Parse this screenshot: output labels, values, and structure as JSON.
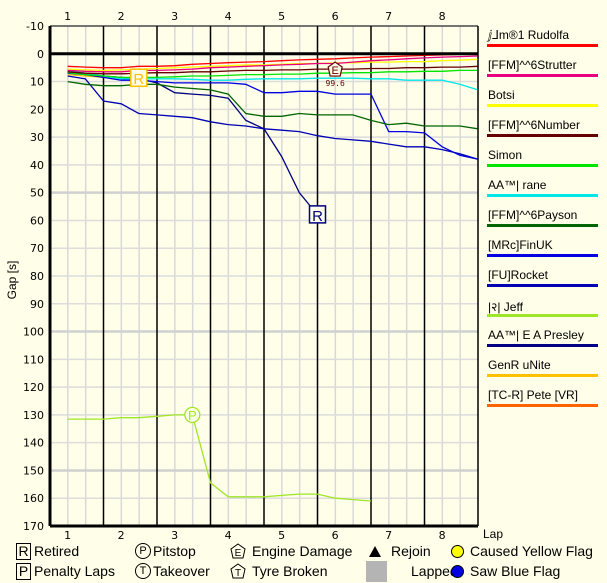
{
  "chart_data": {
    "type": "line",
    "title": "",
    "xlabel": "Lap",
    "ylabel": "Gap [s]",
    "x_ticks": [
      "1",
      "2",
      "3",
      "4",
      "5",
      "6",
      "7",
      "8"
    ],
    "y_ticks": [
      "-10",
      "0",
      "10",
      "20",
      "30",
      "40",
      "50",
      "60",
      "70",
      "80",
      "90",
      "100",
      "110",
      "120",
      "130",
      "140",
      "150",
      "160",
      "170"
    ],
    "xlim": [
      0.67,
      8.67
    ],
    "ylim": [
      -10,
      170
    ],
    "y_inverted": true,
    "grid": true,
    "legend_position": "right",
    "series": [
      {
        "name": "ⅉ⅃m®1 Rudolfa",
        "color": "#ff0000",
        "x": [
          1,
          1.33,
          1.67,
          2,
          2.33,
          2.67,
          3,
          3.33,
          3.67,
          4,
          4.33,
          4.67,
          5,
          5.33,
          5.67,
          6,
          6.33,
          6.67,
          7,
          7.33,
          7.67,
          8,
          8.33,
          8.67
        ],
        "y": [
          4.5,
          4.8,
          5.0,
          5.0,
          4.5,
          4.5,
          4.3,
          3.8,
          3.5,
          3.2,
          3.0,
          2.8,
          2.5,
          2.2,
          2.0,
          1.8,
          1.5,
          1.2,
          1.0,
          0.8,
          0.6,
          0.4,
          0.2,
          0
        ]
      },
      {
        "name": "[FFM]^^6Strutter",
        "color": "#e8007e",
        "x": [
          1,
          1.33,
          1.67,
          2,
          2.33,
          2.67,
          3,
          3.33,
          3.67,
          4,
          4.33,
          4.67,
          5,
          5.33,
          5.67,
          6,
          6.33,
          6.67,
          7,
          7.33,
          7.67,
          8,
          8.33,
          8.67
        ],
        "y": [
          6.0,
          6.3,
          6.5,
          6.5,
          6.0,
          6.0,
          5.8,
          5.5,
          5.0,
          4.8,
          4.5,
          4.3,
          4.0,
          3.8,
          3.5,
          3.5,
          3.0,
          2.5,
          2.2,
          1.8,
          1.5,
          1.2,
          1.0,
          0.8
        ]
      },
      {
        "name": "Botsi",
        "color": "#ffff00",
        "x": [
          1,
          1.33,
          1.67,
          2,
          2.33,
          2.67,
          3,
          3.33,
          3.67,
          4,
          4.33,
          4.67,
          5,
          5.33,
          5.67,
          6,
          6.33,
          6.67,
          7,
          7.33,
          7.67,
          8,
          8.33,
          8.67
        ],
        "y": [
          5.5,
          5.8,
          6.0,
          5.8,
          5.5,
          5.3,
          5.0,
          4.8,
          4.5,
          4.3,
          4.0,
          4.0,
          3.8,
          3.5,
          3.5,
          3.3,
          3.3,
          3.0,
          3.0,
          2.8,
          2.8,
          2.5,
          2.3,
          2.0
        ]
      },
      {
        "name": "[FFM]^^6Number",
        "color": "#640000",
        "x": [
          1,
          1.33,
          1.67,
          2,
          2.33,
          2.67,
          3,
          3.33,
          3.67,
          4,
          4.33,
          4.67,
          5,
          5.33,
          5.67,
          6,
          6.33,
          6.67,
          7,
          7.33,
          7.67,
          8,
          8.33,
          8.67
        ],
        "y": [
          6.5,
          7.0,
          7.2,
          7.2,
          7.0,
          6.8,
          6.8,
          6.5,
          6.5,
          6.2,
          6.0,
          6.0,
          5.8,
          5.8,
          5.5,
          5.5,
          5.5,
          5.3,
          5.3,
          5.0,
          5.0,
          4.8,
          4.8,
          4.5
        ]
      },
      {
        "name": "Simon",
        "color": "#00e400",
        "x": [
          1,
          1.33,
          1.67,
          2,
          2.33,
          2.67,
          3,
          3.33,
          3.67,
          4,
          4.33,
          4.67,
          5,
          5.33,
          5.67,
          6,
          6.33,
          6.67,
          7,
          7.33,
          7.67,
          8,
          8.33,
          8.67
        ],
        "y": [
          6.8,
          7.5,
          8.0,
          8.5,
          8.5,
          8.5,
          8.3,
          8.0,
          8.0,
          7.8,
          7.5,
          7.5,
          7.3,
          7.3,
          7.0,
          7.0,
          6.8,
          6.8,
          6.5,
          6.5,
          6.3,
          6.3,
          6.0,
          6.0
        ]
      },
      {
        "name": "AA™| rane",
        "color": "#00e8e8",
        "x": [
          1,
          1.33,
          1.67,
          2,
          2.33,
          2.67,
          3,
          3.33,
          3.67,
          4,
          4.33,
          4.67,
          5,
          5.33,
          5.67,
          6,
          6.33,
          6.67,
          7,
          7.33,
          7.67,
          8,
          8.33,
          8.67
        ],
        "y": [
          6.0,
          7.0,
          8.0,
          9.0,
          9.0,
          9.0,
          9.0,
          9.2,
          9.5,
          9.5,
          9.2,
          9.0,
          9.0,
          9.0,
          8.8,
          8.8,
          8.8,
          9.0,
          9.0,
          9.5,
          9.5,
          9.5,
          11.0,
          13.0
        ]
      },
      {
        "name": "[FFM]^^6Payson",
        "color": "#006400",
        "x": [
          1,
          1.33,
          1.67,
          2,
          2.33,
          2.67,
          3,
          3.33,
          3.67,
          4,
          4.33,
          4.67,
          5,
          5.33,
          5.67,
          6,
          6.33,
          6.67,
          7,
          7.33,
          7.67,
          8,
          8.33,
          8.67
        ],
        "y": [
          10.0,
          11.0,
          11.5,
          11.5,
          11.0,
          11.0,
          12.0,
          12.5,
          13.0,
          14.5,
          21.5,
          22.5,
          22.5,
          21.5,
          22.0,
          22.0,
          22.0,
          24.0,
          25.5,
          25.0,
          26.0,
          26.0,
          26.0,
          27.0
        ]
      },
      {
        "name": "[MRc]FinUK",
        "color": "#0000e0",
        "x": [
          1,
          1.33,
          1.67,
          2,
          2.33,
          2.67,
          3,
          3.33,
          3.67,
          4,
          4.33,
          4.67,
          5,
          5.33,
          5.67,
          6,
          6.33,
          6.67,
          7,
          7.33,
          7.67,
          8,
          8.33,
          8.67
        ],
        "y": [
          7.0,
          7.5,
          8.5,
          9.5,
          9.5,
          10.0,
          10.5,
          10.5,
          10.5,
          10.5,
          11.0,
          14.0,
          14.0,
          13.5,
          13.5,
          14.5,
          14.5,
          14.5,
          28.0,
          28.0,
          28.5,
          33.5,
          36.5,
          38.0
        ]
      },
      {
        "name": "[FU]Rocket",
        "color": "#0000b4",
        "x": [
          1,
          1.33,
          1.67,
          2,
          2.33,
          2.67,
          3,
          3.33,
          3.67,
          4,
          4.33,
          4.67,
          5,
          5.33,
          5.67,
          6,
          6.33,
          6.67,
          7,
          7.33,
          7.67,
          8,
          8.33,
          8.67
        ],
        "y": [
          8.0,
          9.0,
          17.0,
          18.0,
          21.5,
          22.0,
          22.5,
          23.0,
          24.5,
          25.5,
          26.0,
          27.0,
          27.5,
          28.0,
          29.5,
          30.5,
          31.0,
          31.5,
          32.5,
          33.5,
          33.5,
          34.5,
          36.0,
          38.0
        ]
      },
      {
        "name": "|२| Jeff",
        "color": "#a0e628",
        "x": [
          1,
          1.67,
          2,
          2.33,
          2.67,
          3,
          3.33,
          3.67,
          4,
          4.33,
          4.67,
          5,
          5.33,
          5.67,
          6,
          6.33,
          6.67
        ],
        "y": [
          131.5,
          131.5,
          131.0,
          131.0,
          130.5,
          130.0,
          130.0,
          154.5,
          159.5,
          159.5,
          159.5,
          159.0,
          158.5,
          158.5,
          160.0,
          160.5,
          161.0
        ]
      },
      {
        "name": "AA™| E A Presley",
        "color": "#000080",
        "x": [
          1,
          1.33,
          1.67,
          2,
          2.33,
          2.67,
          3,
          3.33,
          3.67,
          4,
          4.33,
          4.67,
          5,
          5.33,
          5.67
        ],
        "y": [
          6.5,
          7.5,
          8.0,
          8.5,
          9.0,
          10.5,
          14.0,
          14.5,
          15.0,
          16.0,
          24.0,
          27.0,
          37.0,
          50.0,
          58.0
        ]
      },
      {
        "name": "GenR uNite",
        "color": "#ffc000",
        "x": [
          1,
          1.33,
          1.67,
          2,
          2.33
        ],
        "y": [
          7.5,
          8.0,
          8.5,
          8.8,
          8.8
        ]
      },
      {
        "name": "[TC-R] Pete [VR]",
        "color": "#ff6400",
        "x": [],
        "y": []
      }
    ],
    "annotations": [
      {
        "type": "retired",
        "symbol": "R",
        "series": "GenR uNite",
        "x": 2.33,
        "y": 8.8
      },
      {
        "type": "retired",
        "symbol": "R",
        "series": "AA™| E A Presley",
        "x": 5.67,
        "y": 58.0
      },
      {
        "type": "engine-damage",
        "symbol": "E",
        "series": "[FFM]^^6Number",
        "x": 6.0,
        "y": 5.5,
        "label": "99.6"
      },
      {
        "type": "pitstop",
        "symbol": "P",
        "series": "|२| Jeff",
        "x": 3.33,
        "y": 130.0
      }
    ]
  },
  "legend_bottom": {
    "items": [
      {
        "symbol": "R",
        "label": "Retired"
      },
      {
        "symbol": "P",
        "label": "Pitstop"
      },
      {
        "symbol": "E",
        "label": "Engine Damage"
      },
      {
        "symbol": "triangle",
        "label": "Rejoin"
      },
      {
        "symbol": "yellow-dot",
        "label": "Caused Yellow Flag"
      },
      {
        "symbol": "P",
        "label": "Penalty Laps"
      },
      {
        "symbol": "T",
        "label": "Takeover"
      },
      {
        "symbol": "T",
        "label": "Tyre Broken"
      },
      {
        "symbol": "grey-box",
        "label": "Lapped"
      },
      {
        "symbol": "blue-dot",
        "label": "Saw Blue Flag"
      }
    ],
    "yellow_color": "#ffff00",
    "blue_color": "#0000e0"
  }
}
